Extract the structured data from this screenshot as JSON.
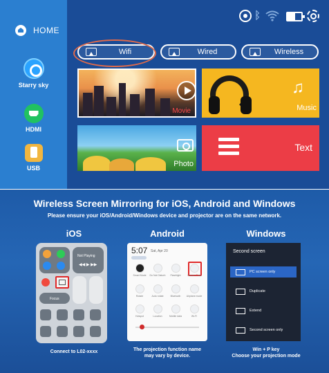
{
  "sidebar": {
    "home": "HOME",
    "items": [
      {
        "label": "Starry sky",
        "icon": "starry-sky-icon"
      },
      {
        "label": "HDMI",
        "icon": "hdmi-icon"
      },
      {
        "label": "USB",
        "icon": "usb-icon"
      }
    ]
  },
  "status_icons": [
    "settings-icon",
    "bluetooth-icon",
    "wifi-icon",
    "battery-icon",
    "gear-icon"
  ],
  "tabs": [
    {
      "label": "Wifi",
      "icon": "cast-icon",
      "highlighted": true
    },
    {
      "label": "Wired",
      "icon": "cast-icon"
    },
    {
      "label": "Wireless",
      "icon": "cast-icon"
    }
  ],
  "tiles": {
    "movie": "Movie",
    "music": "Music",
    "photo": "Photo",
    "text": "Text"
  },
  "instructions": {
    "title": "Wireless Screen Mirroring for iOS, Android and Windows",
    "subtitle": "Please ensure your iOS/Android/Windows device and projector are on the same network.",
    "ios": {
      "heading": "iOS",
      "caption": "Connect to L02-xxxx",
      "now_playing": "Not Playing",
      "focus": "Focus"
    },
    "android": {
      "heading": "Android",
      "time": "5:07",
      "date": "Sat, Apr 20",
      "caption_line1": "The projection function name",
      "caption_line2": "may vary by device.",
      "tiles": [
        "Smart Mode",
        "Do Not Disturb",
        "Flashlight",
        "Screen Cast",
        "Rotate",
        "Auto rotate",
        "Bluetooth",
        "Airplane mode",
        "Hotspot",
        "Location",
        "Mobile data",
        "Wi-Fi"
      ]
    },
    "windows": {
      "heading": "Windows",
      "panel_title": "Second screen",
      "options": [
        "PC screen only",
        "Duplicate",
        "Extend",
        "Second screen only"
      ],
      "caption_line1": "Win + P key",
      "caption_line2": "Choose your projection mode"
    }
  },
  "colors": {
    "home_bg": "#1a4c97",
    "sidebar_bg": "#2b7fd0",
    "highlight_ring": "#e06a4a",
    "music_tile": "#f5b720",
    "text_tile": "#ec3d46",
    "callout": "#e02828"
  }
}
